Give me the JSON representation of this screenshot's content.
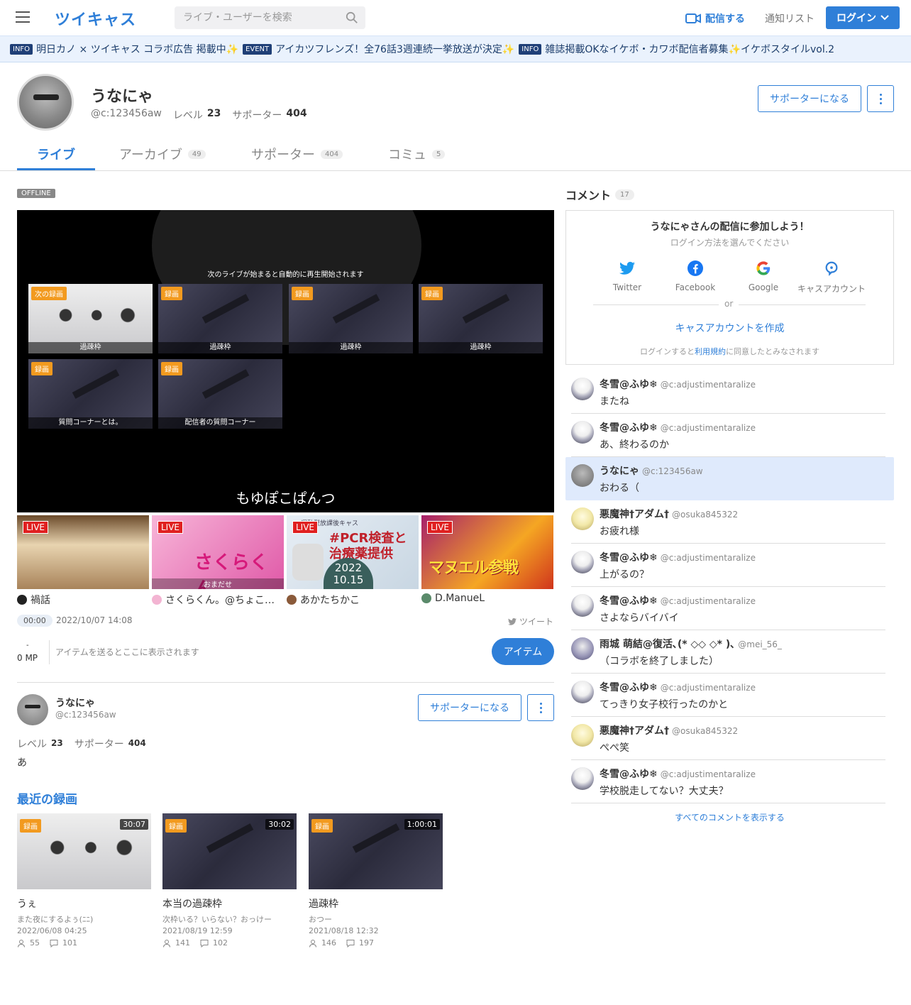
{
  "header": {
    "logo": "ツイキャス",
    "search_placeholder": "ライブ・ユーザーを検索",
    "broadcast_label": "配信する",
    "notification_label": "通知リスト",
    "login_label": "ログイン"
  },
  "info_bar": [
    {
      "tag": "INFO",
      "text": "明日カノ × ツイキャス コラボ広告 掲載中✨"
    },
    {
      "tag": "EVENT",
      "text": "アイカツフレンズ！全76話3週連続一挙放送が決定✨"
    },
    {
      "tag": "INFO",
      "text": "雑誌掲載OKなイケボ・カワボ配信者募集✨イケボスタイルvol.2"
    }
  ],
  "profile": {
    "name": "うなにゃ",
    "id": "@c:123456aw",
    "level_label": "レベル",
    "level": "23",
    "supporter_label": "サポーター",
    "supporters": "404",
    "supporter_button": "サポーターになる"
  },
  "tabs": [
    {
      "label": "ライブ",
      "count": ""
    },
    {
      "label": "アーカイブ",
      "count": "49"
    },
    {
      "label": "サポーター",
      "count": "404"
    },
    {
      "label": "コミュ",
      "count": "5"
    }
  ],
  "player": {
    "status": "OFFLINE",
    "next_message": "次のライブが始まると自動的に再生開始されます",
    "title": "もゆぽこぱんつ",
    "videos": [
      {
        "badge": "次の録画",
        "caption": "過疎枠",
        "thumb": "cat"
      },
      {
        "badge": "録画",
        "caption": "過疎枠",
        "thumb": "dark"
      },
      {
        "badge": "録画",
        "caption": "過疎枠",
        "thumb": "dark"
      },
      {
        "badge": "録画",
        "caption": "過疎枠",
        "thumb": "dark"
      },
      {
        "badge": "録画",
        "caption": "質問コーナーとは。",
        "thumb": "dark"
      },
      {
        "badge": "録画",
        "caption": "配信者の質問コーナー",
        "thumb": "dark"
      }
    ]
  },
  "live_cards": [
    {
      "badge": "LIVE",
      "name": "禍話",
      "thumb_text": ""
    },
    {
      "badge": "LIVE",
      "name": "さくらくん。@ちょこ…",
      "thumb_text": "さくらくん。",
      "thumb_sub": "おまだせ"
    },
    {
      "badge": "LIVE",
      "name": "あかたちかこ",
      "thumb_text": "#PCR検査と治療薬提供",
      "thumb_date": "2022 10.15",
      "thumb_top": "運動型放課後キャス"
    },
    {
      "badge": "LIVE",
      "name": "D.ManueL",
      "thumb_text": "マヌエル参戦"
    }
  ],
  "meta": {
    "time": "00:00",
    "datetime": "2022/10/07 14:08",
    "tweet": "ツイート"
  },
  "items": {
    "mp_dash": "-",
    "mp": "0 MP",
    "message": "アイテムを送るとここに表示されます",
    "button": "アイテム"
  },
  "streamer": {
    "name": "うなにゃ",
    "id": "@c:123456aw",
    "supporter_button": "サポーターになる",
    "level_label": "レベル",
    "level": "23",
    "supporter_label": "サポーター",
    "supporters": "404",
    "bio": "あ"
  },
  "recent": {
    "heading": "最近の録画",
    "items": [
      {
        "badge": "録画",
        "duration": "30:07",
        "title": "うぇ",
        "subtitle": "また夜にするよぅ(ﾆﾆ)",
        "date": "2022/06/08 04:25",
        "viewers": "55",
        "comments": "101",
        "thumb": "cat"
      },
      {
        "badge": "録画",
        "duration": "30:02",
        "title": "本当の過疎枠",
        "subtitle": "次枠いる？いらない？おっけー",
        "date": "2021/08/19 12:59",
        "viewers": "141",
        "comments": "102",
        "thumb": "dark"
      },
      {
        "badge": "録画",
        "duration": "1:00:01",
        "title": "過疎枠",
        "subtitle": "おつー",
        "date": "2021/08/18 12:32",
        "viewers": "146",
        "comments": "197",
        "thumb": "dark"
      }
    ]
  },
  "comments_panel": {
    "heading": "コメント",
    "count": "17",
    "login_title": "うなにゃさんの配信に参加しよう！",
    "login_sub": "ログイン方法を選んでください",
    "sns": [
      "Twitter",
      "Facebook",
      "Google",
      "キャスアカウント"
    ],
    "or": "or",
    "create_account": "キャスアカウントを作成",
    "terms_prefix": "ログインすると",
    "terms_link": "利用規約",
    "terms_suffix": "に同意したとみなされます",
    "show_all": "すべてのコメントを表示する"
  },
  "comments": [
    {
      "name": "冬雪@ふゆ❄",
      "id": "@c:adjustimentaralize",
      "text": "またね",
      "avatar": "fuyu",
      "highlight": false
    },
    {
      "name": "冬雪@ふゆ❄",
      "id": "@c:adjustimentaralize",
      "text": "あ、終わるのか",
      "avatar": "fuyu",
      "highlight": false
    },
    {
      "name": "うなにゃ",
      "id": "@c:123456aw",
      "text": "おわる（",
      "avatar": "una",
      "highlight": true
    },
    {
      "name": "悪魔神†アダム†",
      "id": "@osuka845322",
      "text": "お疲れ様",
      "avatar": "akuma",
      "highlight": false
    },
    {
      "name": "冬雪@ふゆ❄",
      "id": "@c:adjustimentaralize",
      "text": "上がるの？",
      "avatar": "fuyu",
      "highlight": false
    },
    {
      "name": "冬雪@ふゆ❄",
      "id": "@c:adjustimentaralize",
      "text": "さよならバイバイ",
      "avatar": "fuyu",
      "highlight": false
    },
    {
      "name": "雨城 萌結@復活､(* ◇◇ ◇* )､",
      "id": "@mei_56_",
      "text": "（コラボを終了しました）",
      "avatar": "mei",
      "highlight": false
    },
    {
      "name": "冬雪@ふゆ❄",
      "id": "@c:adjustimentaralize",
      "text": "てっきり女子校行ったのかと",
      "avatar": "fuyu",
      "highlight": false
    },
    {
      "name": "悪魔神†アダム†",
      "id": "@osuka845322",
      "text": "ぺぺ笑",
      "avatar": "akuma",
      "highlight": false
    },
    {
      "name": "冬雪@ふゆ❄",
      "id": "@c:adjustimentaralize",
      "text": "学校脱走してない？大丈夫？",
      "avatar": "fuyu",
      "highlight": false
    }
  ],
  "colors": {
    "brand": "#2f7fd8",
    "record_badge": "#f29a1f",
    "live_badge": "#e02020",
    "highlight": "#dfeafc"
  }
}
